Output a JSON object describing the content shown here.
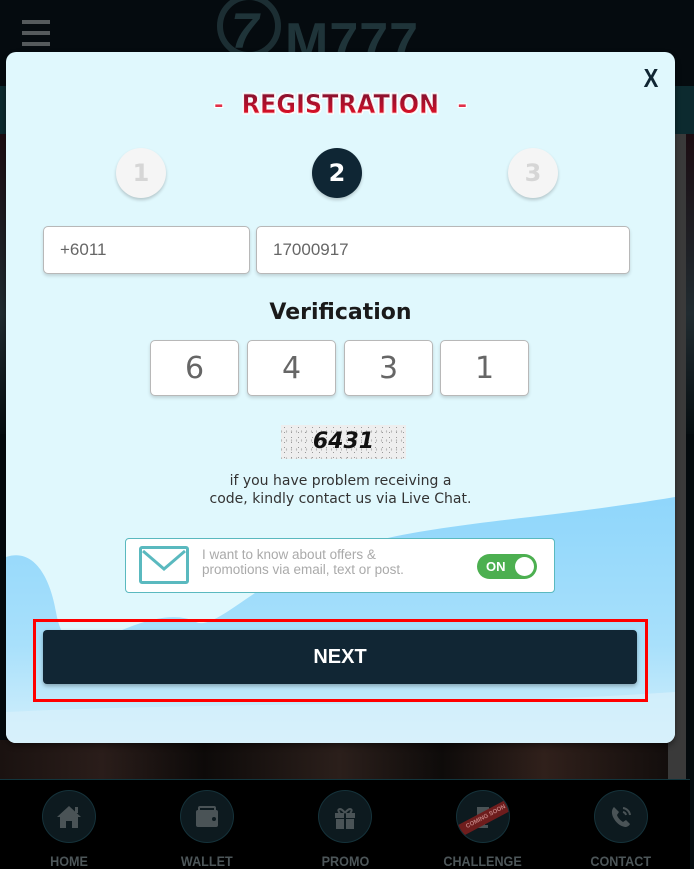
{
  "app": {
    "logo_text": "M777",
    "logo_mark": "7"
  },
  "modal": {
    "close_label": "X",
    "title": "REGISTRATION",
    "title_decorator": "-",
    "steps": [
      {
        "label": "1",
        "state": "inactive"
      },
      {
        "label": "2",
        "state": "active"
      },
      {
        "label": "3",
        "state": "inactive"
      }
    ],
    "phone": {
      "country_code": "+6011",
      "number": "17000917"
    },
    "verification": {
      "label": "Verification",
      "digits": [
        "6",
        "4",
        "3",
        "1"
      ],
      "captcha": "6431",
      "help_text_line1": "if you have problem receiving a",
      "help_text_line2": "code, kindly contact us via Live Chat."
    },
    "optin": {
      "text_line1": "I want to know about offers &",
      "text_line2": "promotions via email, text or post.",
      "toggle_label": "ON",
      "toggle_on": true
    },
    "next_label": "NEXT"
  },
  "bottom_nav": [
    {
      "label": "HOME",
      "icon": "home-icon"
    },
    {
      "label": "WALLET",
      "icon": "wallet-icon"
    },
    {
      "label": "PROMO",
      "icon": "gift-icon"
    },
    {
      "label": "CHALLENGE",
      "icon": "trophy-icon",
      "badge": "COMING SOON"
    },
    {
      "label": "CONTACT",
      "icon": "phone-icon"
    }
  ],
  "colors": {
    "modal_bg": "#e0f8fd",
    "primary_dark": "#112634",
    "toggle_on": "#4caf50",
    "accent_teal": "#5ab9bf",
    "highlight": "#ff0000"
  }
}
